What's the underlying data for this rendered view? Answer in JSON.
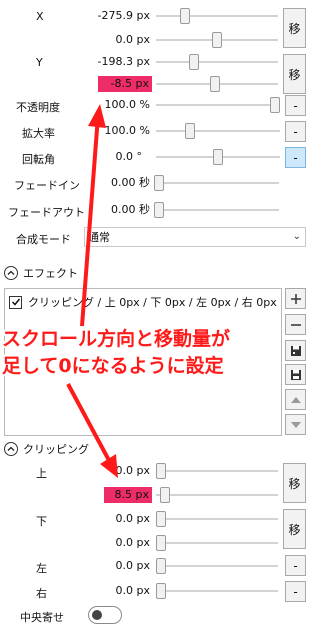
{
  "transform": {
    "rows": [
      {
        "id": "x",
        "label": "X",
        "value": "-275.9 px",
        "slider": 0.22,
        "highlight": false
      },
      {
        "id": "x2",
        "label": "",
        "value": "0.0 px",
        "slider": 0.5,
        "highlight": false
      },
      {
        "id": "y",
        "label": "Y",
        "value": "-198.3 px",
        "slider": 0.3,
        "highlight": false
      },
      {
        "id": "y2",
        "label": "",
        "value": "-8.5 px",
        "slider": 0.47,
        "highlight": true
      },
      {
        "id": "opacity",
        "label": "不透明度",
        "value": "100.0 %",
        "slider": 1.0,
        "highlight": false
      },
      {
        "id": "scale",
        "label": "拡大率",
        "value": "100.0 %",
        "slider": 0.25,
        "highlight": false
      },
      {
        "id": "rotation",
        "label": "回転角",
        "value": "0.0 °",
        "slider": 0.5,
        "highlight": false
      },
      {
        "id": "fadein",
        "label": "フェードイン",
        "value": "0.00 秒",
        "slider": 0.0,
        "highlight": false
      },
      {
        "id": "fadeout",
        "label": "フェードアウト",
        "value": "0.00 秒",
        "slider": 0.0,
        "highlight": false
      }
    ],
    "move_label": "移",
    "dash_label": "-",
    "blend_label": "合成モード",
    "blend_value": "通常"
  },
  "effects": {
    "title": "エフェクト",
    "items": [
      {
        "label": "クリッピング / 上 0px / 下 0px / 左 0px / 右 0px",
        "checked": true
      }
    ]
  },
  "clipping": {
    "title": "クリッピング",
    "rows": [
      {
        "id": "top",
        "label": "上",
        "value": "0.0 px",
        "slider": 0.0,
        "highlight": false
      },
      {
        "id": "top2",
        "label": "",
        "value": "8.5 px",
        "slider": 0.03,
        "highlight": true
      },
      {
        "id": "bottom",
        "label": "下",
        "value": "0.0 px",
        "slider": 0.0,
        "highlight": false
      },
      {
        "id": "bottom2",
        "label": "",
        "value": "0.0 px",
        "slider": 0.0,
        "highlight": false
      },
      {
        "id": "left",
        "label": "左",
        "value": "0.0 px",
        "slider": 0.0,
        "highlight": false
      },
      {
        "id": "right",
        "label": "右",
        "value": "0.0 px",
        "slider": 0.0,
        "highlight": false
      }
    ],
    "center_label": "中央寄せ"
  },
  "annotation": {
    "line1": "スクロール方向と移動量が",
    "line2": "足して0になるように設定",
    "color": "#ff1a1a"
  },
  "colors": {
    "highlight": "#ee2c68",
    "active_button": "#cde8fb"
  }
}
